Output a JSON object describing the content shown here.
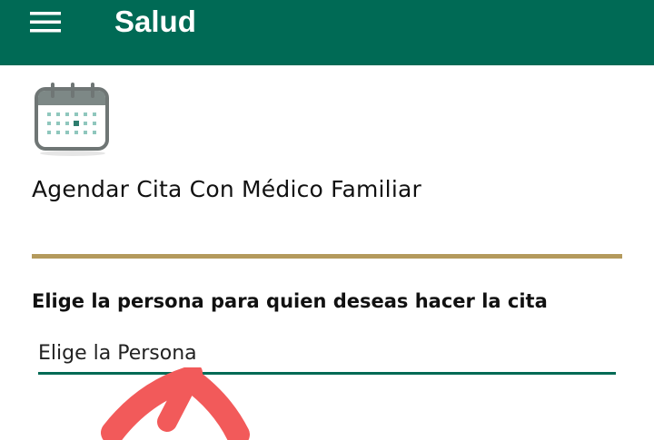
{
  "header": {
    "title": "Salud",
    "background_color": "#006a55",
    "menu_icon": "hamburger-menu-icon"
  },
  "card": {
    "icon": "calendar-icon",
    "title": "Agendar Cita Con Médico Familiar",
    "divider_color": "#b49a5c"
  },
  "form": {
    "prompt": "Elige la persona para quien deseas hacer la cita",
    "person_select": {
      "placeholder": "Elige la Persona",
      "underline_color": "#006a55"
    }
  },
  "annotation": {
    "icon": "arrow-up-icon",
    "color": "#f25a5a"
  }
}
